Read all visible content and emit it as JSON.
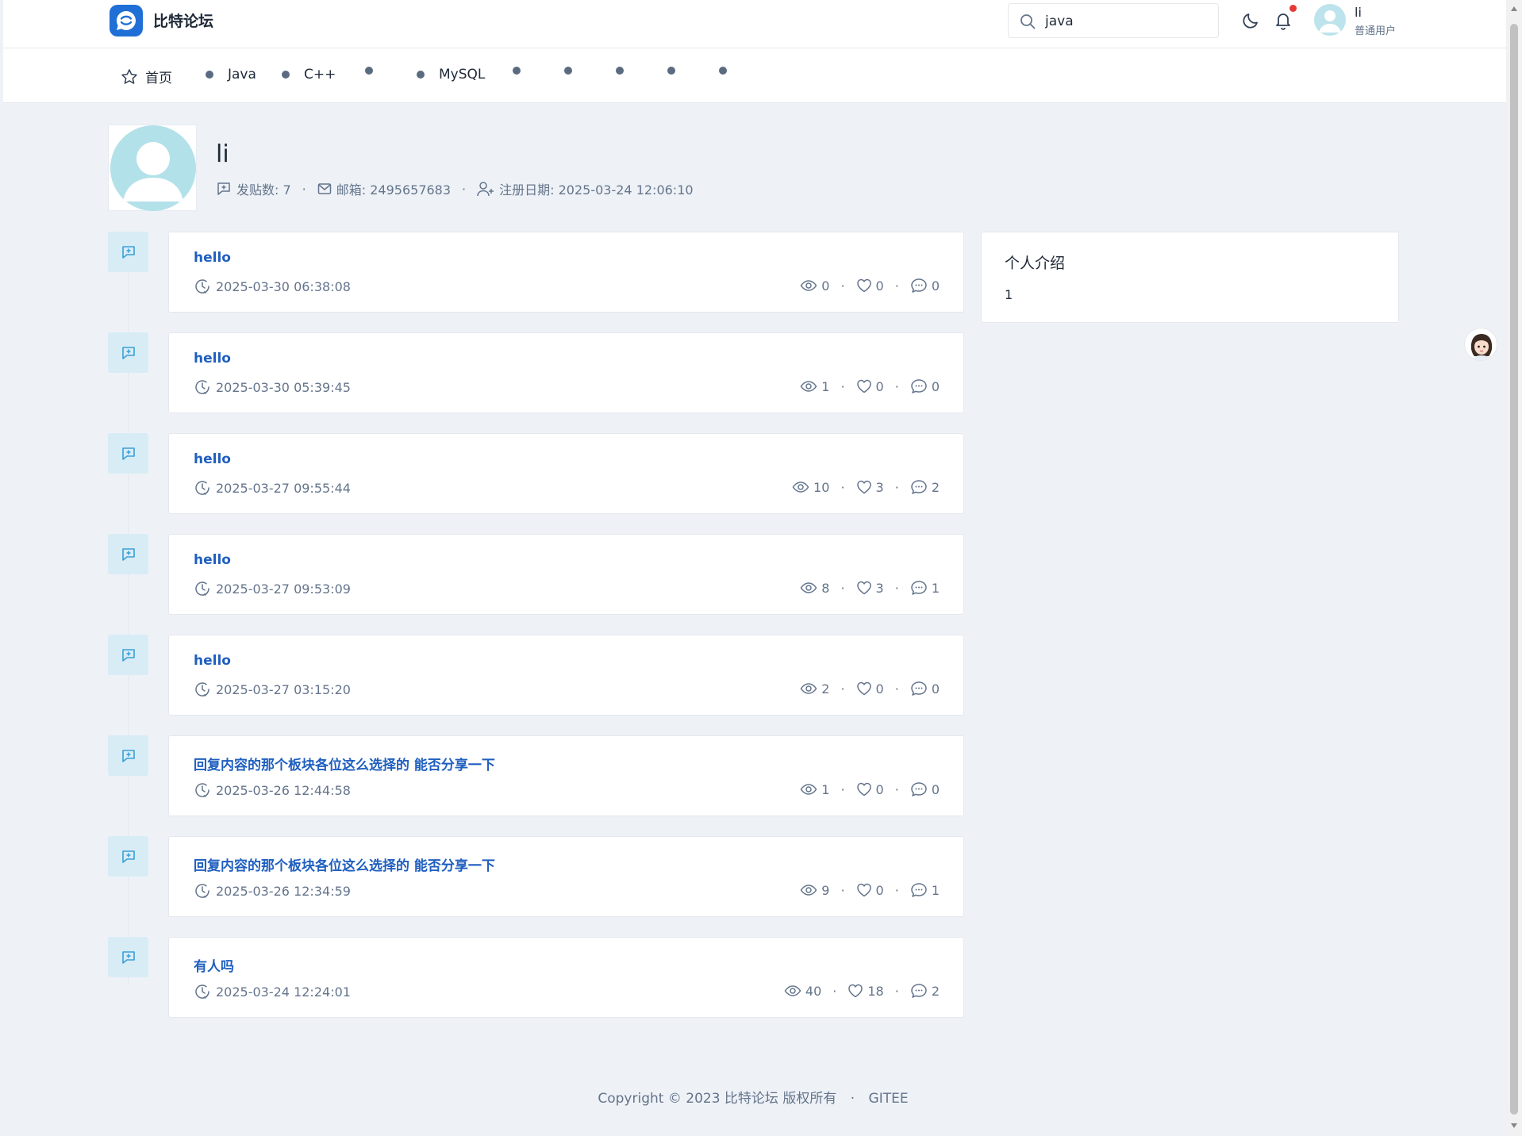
{
  "header": {
    "site_name": "比特论坛",
    "search_value": "java",
    "user": {
      "name": "li",
      "role": "普通用户"
    }
  },
  "nav": {
    "items": [
      {
        "label": "首页",
        "icon": "star-icon"
      },
      {
        "label": "Java",
        "icon": "dot"
      },
      {
        "label": "C++",
        "icon": "dot"
      },
      {
        "label": "",
        "icon": "dot"
      },
      {
        "label": "MySQL",
        "icon": "dot"
      },
      {
        "label": "",
        "icon": "dot"
      },
      {
        "label": "",
        "icon": "dot"
      },
      {
        "label": "",
        "icon": "dot"
      },
      {
        "label": "",
        "icon": "dot"
      },
      {
        "label": "",
        "icon": "dot"
      }
    ]
  },
  "profile": {
    "name": "li",
    "post_count": "发贴数: 7",
    "email": "邮箱: 2495657683",
    "registered": "注册日期: 2025-03-24 12:06:10"
  },
  "posts": [
    {
      "title": "hello",
      "time": "2025-03-30 06:38:08",
      "views": "0",
      "likes": "0",
      "comments": "0"
    },
    {
      "title": "hello",
      "time": "2025-03-30 05:39:45",
      "views": "1",
      "likes": "0",
      "comments": "0"
    },
    {
      "title": "hello",
      "time": "2025-03-27 09:55:44",
      "views": "10",
      "likes": "3",
      "comments": "2"
    },
    {
      "title": "hello",
      "time": "2025-03-27 09:53:09",
      "views": "8",
      "likes": "3",
      "comments": "1"
    },
    {
      "title": "hello",
      "time": "2025-03-27 03:15:20",
      "views": "2",
      "likes": "0",
      "comments": "0"
    },
    {
      "title": "回复内容的那个板块各位这么选择的 能否分享一下",
      "time": "2025-03-26 12:44:58",
      "views": "1",
      "likes": "0",
      "comments": "0"
    },
    {
      "title": "回复内容的那个板块各位这么选择的 能否分享一下",
      "time": "2025-03-26 12:34:59",
      "views": "9",
      "likes": "0",
      "comments": "1"
    },
    {
      "title": "有人吗",
      "time": "2025-03-24 12:24:01",
      "views": "40",
      "likes": "18",
      "comments": "2"
    }
  ],
  "sidebar": {
    "intro_title": "个人介绍",
    "intro_body": "1"
  },
  "footer": {
    "copyright": "Copyright © 2023 比特论坛 版权所有",
    "separator": "·",
    "link": "GITEE"
  },
  "colors": {
    "brand": "#1f6fd6",
    "post_title": "#1f5fbf",
    "page_bg": "#eef2f7",
    "notification_dot": "#e53935"
  }
}
